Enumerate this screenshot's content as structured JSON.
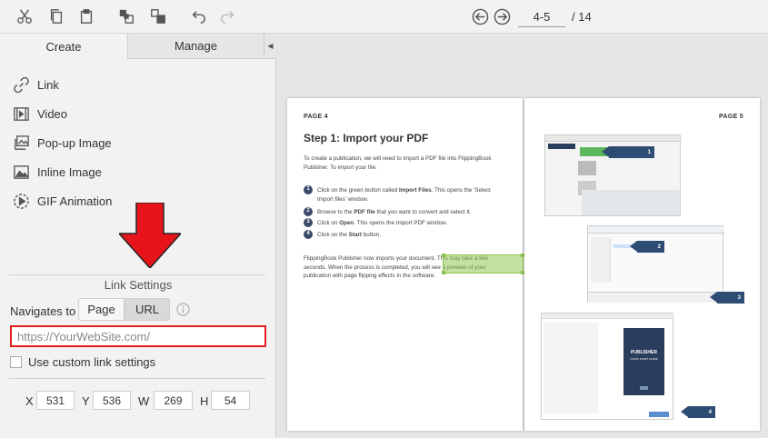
{
  "toolbar": {
    "icons": [
      "cut-icon",
      "copy-icon",
      "paste-icon",
      "bring-forward-icon",
      "send-backward-icon",
      "undo-icon",
      "redo-icon"
    ],
    "page_value": "4-5",
    "page_total": "/ 14"
  },
  "left_panel": {
    "tabs": [
      {
        "label": "Create",
        "active": true
      },
      {
        "label": "Manage",
        "active": false
      }
    ],
    "tools": [
      {
        "label": "Link",
        "icon": "link-icon"
      },
      {
        "label": "Video",
        "icon": "video-icon"
      },
      {
        "label": "Pop-up Image",
        "icon": "popup-image-icon"
      },
      {
        "label": "Inline Image",
        "icon": "inline-image-icon"
      },
      {
        "label": "GIF Animation",
        "icon": "gif-animation-icon"
      }
    ],
    "settings_title": "Link Settings",
    "navigates_to": {
      "label": "Navigates to",
      "options": [
        "Page",
        "URL"
      ],
      "selected": "URL"
    },
    "url_placeholder": "https://YourWebSite.com/",
    "custom_link": {
      "label": "Use custom link settings",
      "checked": false
    },
    "geometry": {
      "x_label": "X",
      "x_value": "531",
      "y_label": "Y",
      "y_value": "536",
      "w_label": "W",
      "w_value": "269",
      "h_label": "H",
      "h_value": "54"
    }
  },
  "page_left": {
    "header": "PAGE 4",
    "title": "Step 1: Import your PDF",
    "intro": "To create a publication, we will need to import a PDF file into FlippingBook Publisher. To import your file:",
    "steps": [
      {
        "num": "1",
        "pre": "Click on the green button called ",
        "bold": "Import Files",
        "post": ". This opens the 'Select Import files' window."
      },
      {
        "num": "2",
        "pre": "Browse to the ",
        "bold": "PDF file",
        "post": " that you want to convert and select it."
      },
      {
        "num": "3",
        "pre": "Click on ",
        "bold": "Open",
        "post": ". This opens the Import PDF window."
      },
      {
        "num": "4",
        "pre": "Click on the ",
        "bold": "Start",
        "post": " button."
      }
    ],
    "outro": "FlippingBook Publisher now imports your document. This may take a few seconds. When the process is completed, you will see a preview of your publication with page flipping effects in the software."
  },
  "page_right": {
    "header": "PAGE 5",
    "callouts": [
      "1",
      "2",
      "3",
      "4"
    ],
    "book_title": "PUBLISHER",
    "book_subtitle": "QUICK START GUIDE"
  },
  "colors": {
    "highlight_red": "#e02020",
    "link_green": "#8bc34a",
    "callout_blue": "#2e4d75"
  }
}
